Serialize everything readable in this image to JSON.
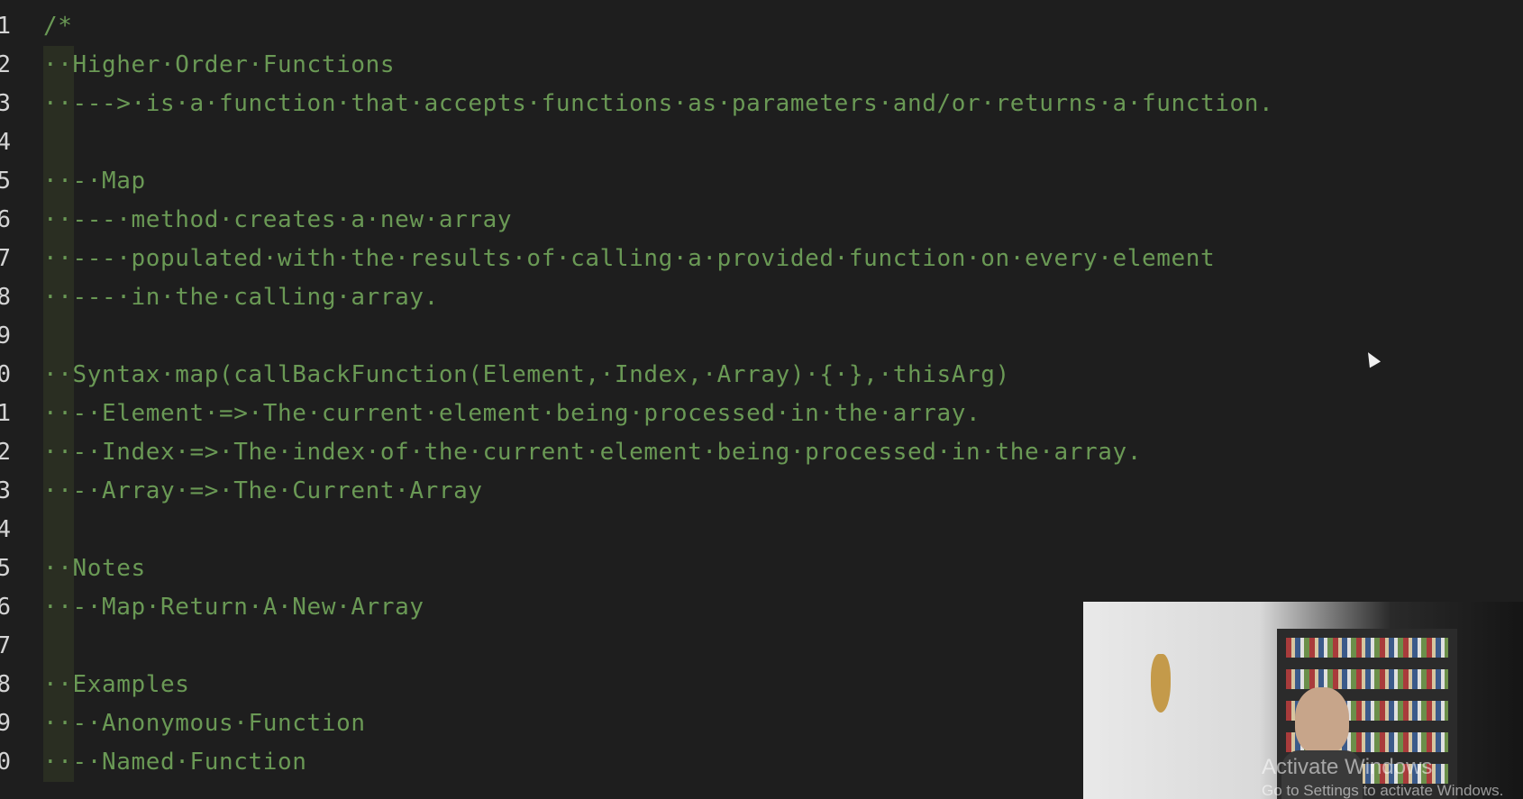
{
  "editor": {
    "lines": [
      {
        "num": "1",
        "text": "/*"
      },
      {
        "num": "2",
        "text": "··Higher·Order·Functions"
      },
      {
        "num": "3",
        "text": "··--->·is·a·function·that·accepts·functions·as·parameters·and/or·returns·a·function."
      },
      {
        "num": "4",
        "text": ""
      },
      {
        "num": "5",
        "text": "··-·Map"
      },
      {
        "num": "6",
        "text": "··---·method·creates·a·new·array"
      },
      {
        "num": "7",
        "text": "··---·populated·with·the·results·of·calling·a·provided·function·on·every·element"
      },
      {
        "num": "8",
        "text": "··---·in·the·calling·array."
      },
      {
        "num": "9",
        "text": ""
      },
      {
        "num": "0",
        "text": "··Syntax·map(callBackFunction(Element,·Index,·Array)·{·},·thisArg)"
      },
      {
        "num": "1",
        "text": "··-·Element·=>·The·current·element·being·processed·in·the·array."
      },
      {
        "num": "2",
        "text": "··-·Index·=>·The·index·of·the·current·element·being·processed·in·the·array."
      },
      {
        "num": "3",
        "text": "··-·Array·=>·The·Current·Array"
      },
      {
        "num": "4",
        "text": ""
      },
      {
        "num": "5",
        "text": "··Notes"
      },
      {
        "num": "6",
        "text": "··-·Map·Return·A·New·Array"
      },
      {
        "num": "7",
        "text": ""
      },
      {
        "num": "8",
        "text": "··Examples"
      },
      {
        "num": "9",
        "text": "··-·Anonymous·Function"
      },
      {
        "num": "0",
        "text": "··-·Named·Function"
      }
    ]
  },
  "watermark": {
    "title": "Activate Windows",
    "subtitle": "Go to Settings to activate Windows."
  },
  "colors": {
    "background": "#1e1e1e",
    "comment": "#6a9955",
    "line_number": "#d4d4d4"
  }
}
